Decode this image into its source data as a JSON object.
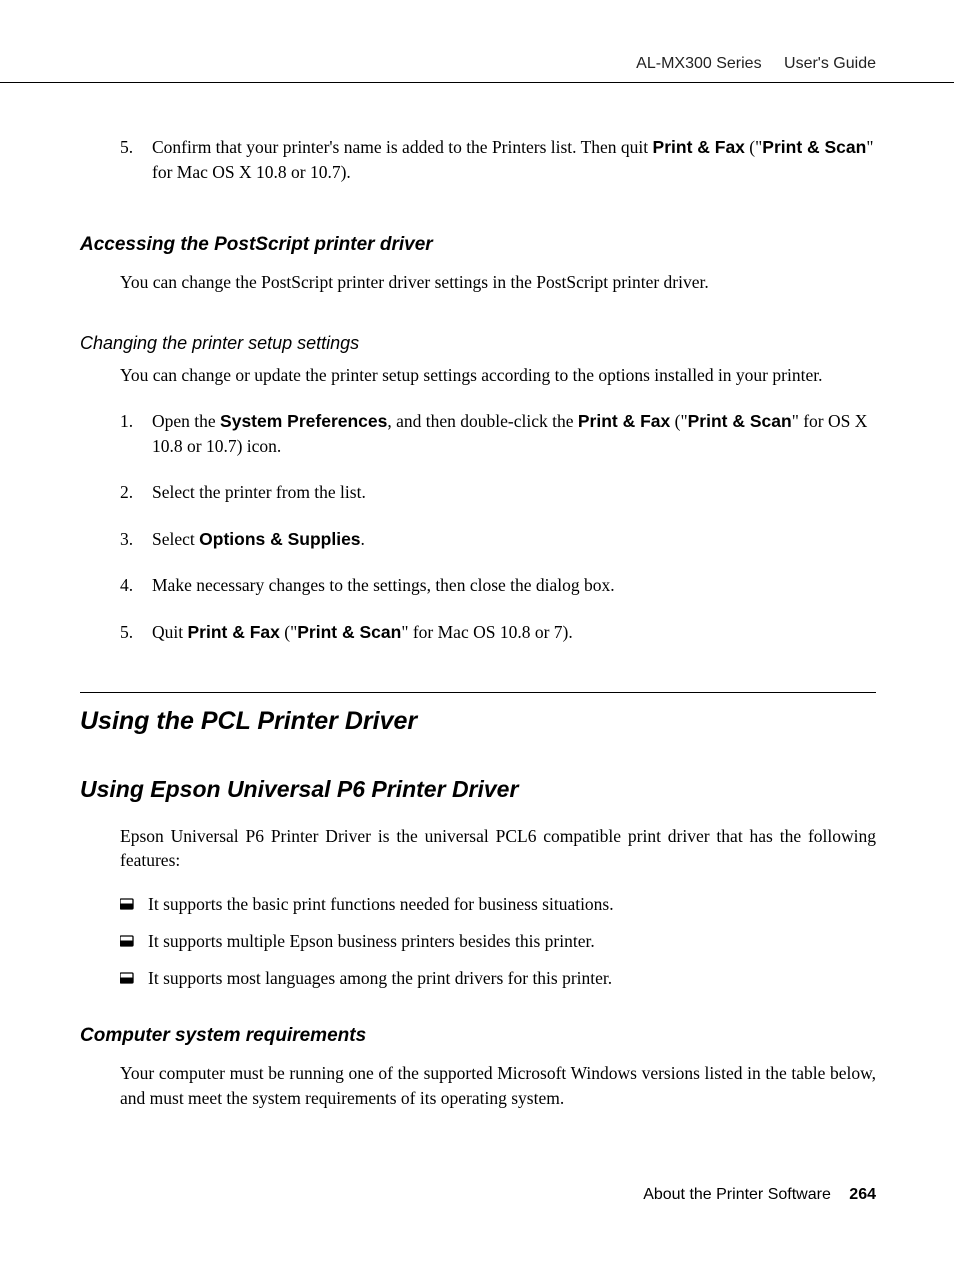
{
  "header": {
    "series": "AL-MX300 Series",
    "doc_title": "User's Guide"
  },
  "top_step": {
    "num": "5.",
    "text_1": "Confirm that your printer's name is added to the Printers list. Then quit ",
    "bold_1": "Print & Fax",
    "text_2": " (\"",
    "bold_2": "Print & Scan",
    "text_3": "\" for Mac OS X 10.8 or 10.7)."
  },
  "section_access": {
    "heading": "Accessing the PostScript printer driver",
    "para": "You can change the PostScript printer driver settings in the PostScript printer driver."
  },
  "section_change": {
    "subheading": "Changing the printer setup settings",
    "para": "You can change or update the printer setup settings according to the options installed in your printer.",
    "steps": {
      "s1": {
        "num": "1.",
        "t1": "Open the ",
        "b1": "System Preferences",
        "t2": ", and then double-click the ",
        "b2": "Print & Fax",
        "t3": " (\"",
        "b3": "Print & Scan",
        "t4": "\" for OS X 10.8 or 10.7) icon."
      },
      "s2": {
        "num": "2.",
        "t1": "Select the printer from the list."
      },
      "s3": {
        "num": "3.",
        "t1": "Select ",
        "b1": "Options & Supplies",
        "t2": "."
      },
      "s4": {
        "num": "4.",
        "t1": "Make necessary changes to the settings, then close the dialog box."
      },
      "s5": {
        "num": "5.",
        "t1": "Quit ",
        "b1": "Print & Fax",
        "t2": " (\"",
        "b2": "Print & Scan",
        "t3": "\" for Mac OS 10.8 or 7)."
      }
    }
  },
  "section_pcl": {
    "h1": "Using the PCL Printer Driver",
    "h2": "Using Epson Universal P6 Printer Driver",
    "para": "Epson Universal P6 Printer Driver is the universal PCL6 compatible print driver that has the following features:",
    "bullets": {
      "b1": "It supports the basic print functions needed for business situations.",
      "b2": "It supports multiple Epson business printers besides this printer.",
      "b3": "It supports most languages among the print drivers for this printer."
    }
  },
  "section_req": {
    "heading": "Computer system requirements",
    "para": "Your computer must be running one of the supported Microsoft Windows versions listed in the table below, and must meet the system requirements of its operating system."
  },
  "footer": {
    "chapter": "About the Printer Software",
    "page": "264"
  }
}
